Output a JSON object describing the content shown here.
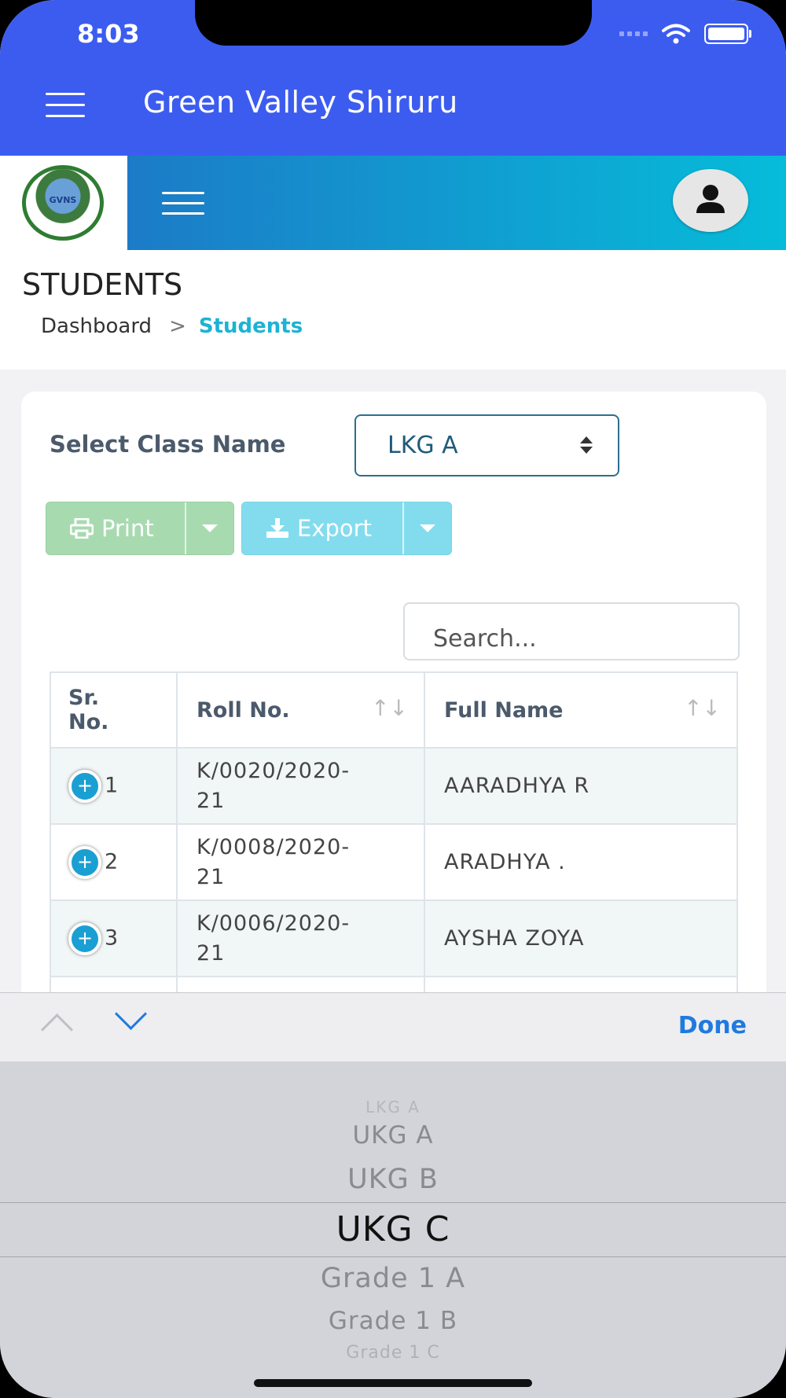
{
  "status_bar": {
    "time": "8:03"
  },
  "app_bar": {
    "title": "Green Valley Shiruru"
  },
  "logo": {
    "text": "GVNS"
  },
  "page": {
    "title": "STUDENTS",
    "breadcrumb": {
      "home": "Dashboard",
      "current": "Students"
    }
  },
  "filter": {
    "label": "Select Class Name",
    "selected": "LKG A"
  },
  "toolbar": {
    "print_label": "Print",
    "export_label": "Export"
  },
  "search": {
    "placeholder": "Search..."
  },
  "table": {
    "headers": {
      "sr_line1": "Sr.",
      "sr_line2": "No.",
      "roll": "Roll No.",
      "name": "Full Name"
    },
    "rows": [
      {
        "sr": "1",
        "roll_line1": "K/0020/2020-",
        "roll_line2": "21",
        "name": "AARADHYA R"
      },
      {
        "sr": "2",
        "roll_line1": "K/0008/2020-",
        "roll_line2": "21",
        "name": "ARADHYA ."
      },
      {
        "sr": "3",
        "roll_line1": "K/0006/2020-",
        "roll_line2": "21",
        "name": "AYSHA ZOYA"
      }
    ]
  },
  "keyboard": {
    "done_label": "Done"
  },
  "picker": {
    "options": [
      "LKG A",
      "UKG A",
      "UKG B",
      "UKG C",
      "Grade 1 A",
      "Grade 1 B",
      "Grade 1 C"
    ],
    "selected": "UKG C"
  },
  "colors": {
    "primary": "#3c5cf0",
    "accent": "#1bb3d4",
    "print": "#a8dab0",
    "export": "#83dcee",
    "ios_blue": "#1f7ae0"
  }
}
